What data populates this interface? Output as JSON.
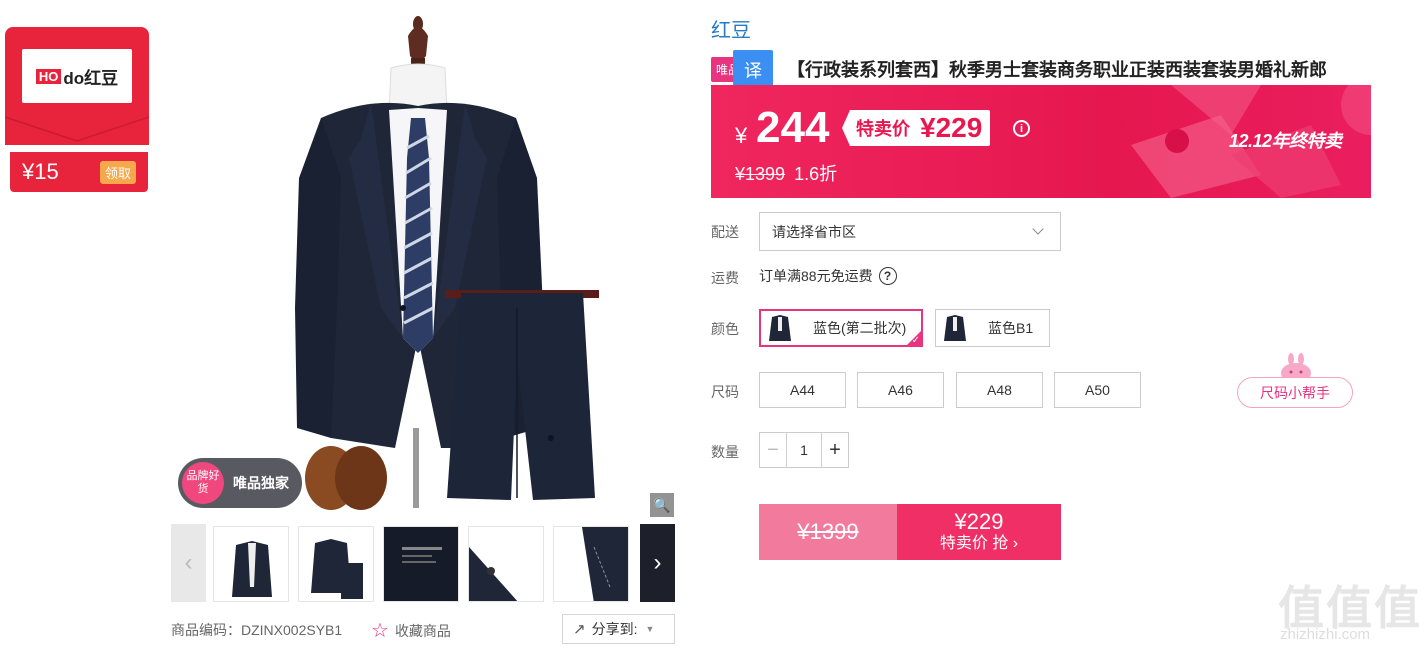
{
  "coupon": {
    "logo_prefix": "HO",
    "logo_suffix": "do红豆",
    "amount": "¥15",
    "claim_label": "领取"
  },
  "gallery": {
    "exclusive_badge": "品牌好货",
    "exclusive_text": "唯品独家",
    "zoom_icon": "magnifier-icon",
    "thumbnails": [
      {
        "name": "thumb-suit-front"
      },
      {
        "name": "thumb-suit-set"
      },
      {
        "name": "thumb-fabric-text"
      },
      {
        "name": "thumb-detail-button"
      },
      {
        "name": "thumb-detail-lapel"
      }
    ]
  },
  "meta": {
    "product_code": "商品编码：DZINX002SYB1",
    "favorite_label": "收藏商品",
    "share_label": "分享到:"
  },
  "product": {
    "brand": "红豆",
    "tag_vip": "唯品",
    "tag_translate": "译",
    "title": "【行政装系列套西】秋季男士套装商务职业正装西装套装男婚礼新郎"
  },
  "price": {
    "currency": "¥",
    "current": "244",
    "special_label": "特卖价",
    "special_price": "¥229",
    "original": "¥1399",
    "discount": "1.6折",
    "promo": "12.12年终特卖"
  },
  "options": {
    "delivery_label": "配送",
    "delivery_placeholder": "请选择省市区",
    "shipping_label": "运费",
    "shipping_text": "订单满88元免运费",
    "color_label": "颜色",
    "colors": [
      {
        "label": "蓝色(第二批次)",
        "selected": true
      },
      {
        "label": "蓝色B1",
        "selected": false
      }
    ],
    "size_label": "尺码",
    "sizes": [
      "A44",
      "A46",
      "A48",
      "A50"
    ],
    "size_helper": "尺码小帮手",
    "qty_label": "数量",
    "qty_value": "1"
  },
  "buy": {
    "original": "¥1399",
    "price": "¥229",
    "label": "特卖价 抢"
  },
  "watermark": {
    "chars": "值值值",
    "url": "zhizhizhi.com"
  },
  "colors": {
    "accent": "#e8337f",
    "banner": "#e6174f",
    "brand_link": "#2a7ac0",
    "suit": "#1e2638"
  }
}
